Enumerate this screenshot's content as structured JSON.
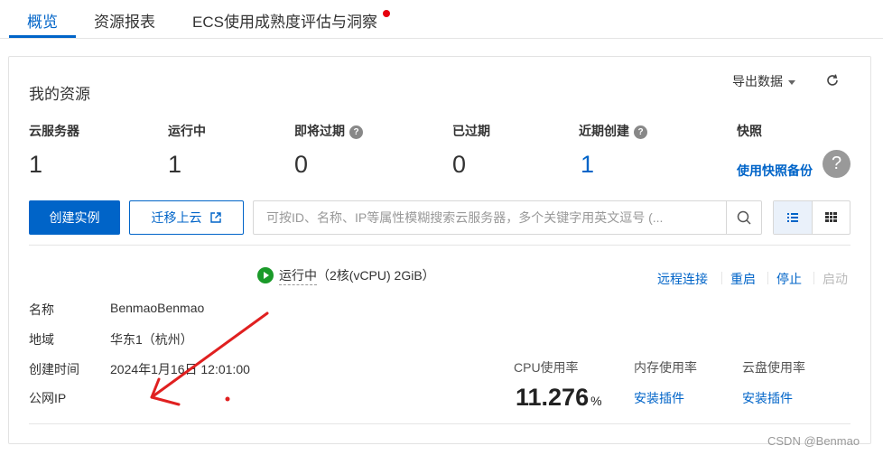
{
  "tabs": [
    {
      "label": "概览",
      "active": true
    },
    {
      "label": "资源报表",
      "active": false
    },
    {
      "label": "ECS使用成熟度评估与洞察",
      "active": false,
      "has_dot": true
    }
  ],
  "card": {
    "title": "我的资源",
    "export_label": "导出数据",
    "stats": [
      {
        "label": "云服务器",
        "value": "1"
      },
      {
        "label": "运行中",
        "value": "1"
      },
      {
        "label": "即将过期",
        "value": "0",
        "help": "?"
      },
      {
        "label": "已过期",
        "value": "0"
      },
      {
        "label": "近期创建",
        "value": "1",
        "help": "?"
      },
      {
        "label": "快照",
        "link": "使用快照备份",
        "help": "?"
      }
    ],
    "buttons": {
      "create": "创建实例",
      "migrate": "迁移上云"
    },
    "search": {
      "placeholder": "可按ID、名称、IP等属性模糊搜索云服务器，多个关键字用英文逗号 (..."
    },
    "instance": {
      "status": "运行中",
      "spec": "（2核(vCPU) 2GiB）",
      "actions": [
        {
          "label": "远程连接",
          "enabled": true
        },
        {
          "label": "重启",
          "enabled": true
        },
        {
          "label": "停止",
          "enabled": true
        },
        {
          "label": "启动",
          "enabled": false
        }
      ],
      "fields": [
        {
          "label": "名称",
          "value": "BenmaoBenmao"
        },
        {
          "label": "地域",
          "value": "华东1（杭州）"
        },
        {
          "label": "创建时间",
          "value": "2024年1月16日 12:01:00"
        },
        {
          "label": "公网IP",
          "value": ""
        }
      ],
      "metrics": {
        "cpu_label": "CPU使用率",
        "cpu_value": "11.276",
        "cpu_unit": "%",
        "memory_label": "内存使用率",
        "memory_link": "安装插件",
        "disk_label": "云盘使用率",
        "disk_link": "安装插件"
      }
    }
  },
  "watermark": "CSDN @Benmao⁠",
  "colors": {
    "brand": "#0064c8",
    "running": "#1a9a29",
    "dot": "#e6000e",
    "annotation": "#e02020"
  },
  "icons": [
    "refresh-icon",
    "external-link-icon",
    "search-icon",
    "list-view-icon",
    "grid-view-icon",
    "play-status-icon",
    "question-icon"
  ]
}
